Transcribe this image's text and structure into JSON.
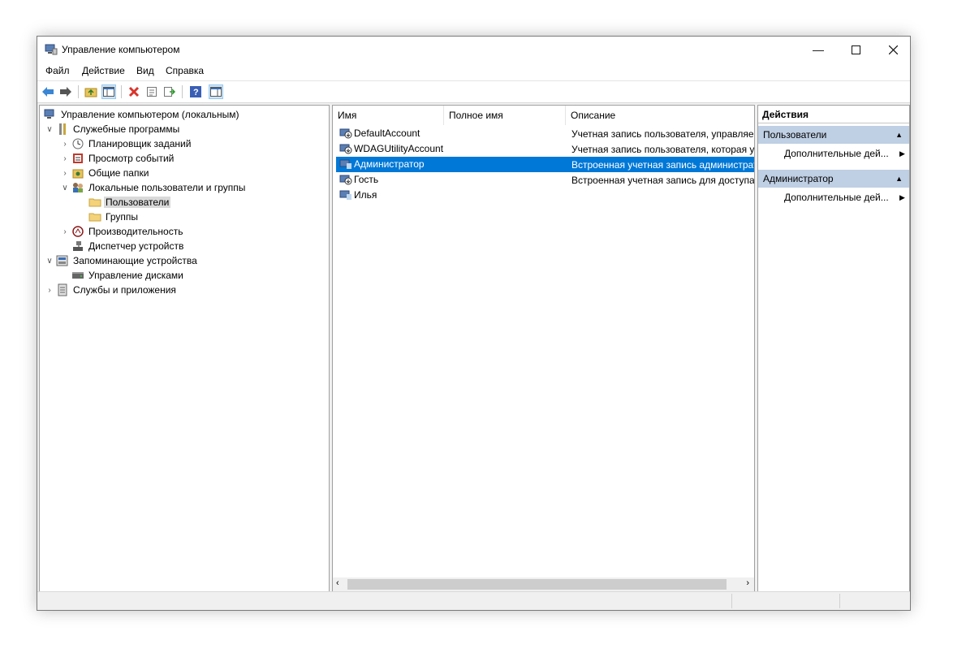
{
  "window": {
    "title": "Управление компьютером"
  },
  "menu": [
    "Файл",
    "Действие",
    "Вид",
    "Справка"
  ],
  "toolbar": {
    "icons": [
      "back-arrow-icon",
      "forward-arrow-icon",
      "up-folder-icon",
      "show-hide-tree-icon",
      "delete-icon",
      "properties-icon",
      "export-icon",
      "help-icon",
      "show-hide-action-pane-icon"
    ]
  },
  "tree": {
    "root": "Управление компьютером (локальным)",
    "system_tools": "Служебные программы",
    "task_scheduler": "Планировщик заданий",
    "event_viewer": "Просмотр событий",
    "shared_folders": "Общие папки",
    "local_users": "Локальные пользователи и группы",
    "users": "Пользователи",
    "groups": "Группы",
    "performance": "Производительность",
    "device_manager": "Диспетчер устройств",
    "storage": "Запоминающие устройства",
    "disk_management": "Управление дисками",
    "services_apps": "Службы и приложения"
  },
  "list": {
    "columns": [
      "Имя",
      "Полное имя",
      "Описание"
    ],
    "rows": [
      {
        "name": "DefaultAccount",
        "full_name": "",
        "description": "Учетная запись пользователя, управляе..."
      },
      {
        "name": "WDAGUtilityAccount",
        "full_name": "",
        "description": "Учетная запись пользователя, которая у..."
      },
      {
        "name": "Администратор",
        "full_name": "",
        "description": "Встроенная учетная запись администрат..."
      },
      {
        "name": "Гость",
        "full_name": "",
        "description": "Встроенная учетная запись для доступа ..."
      },
      {
        "name": "Илья",
        "full_name": "",
        "description": ""
      }
    ],
    "selected_index": 2
  },
  "actions": {
    "title": "Действия",
    "group1": "Пользователи",
    "group1_item": "Дополнительные дей...",
    "group2": "Администратор",
    "group2_item": "Дополнительные дей..."
  },
  "colors": {
    "selection": "#0078d7",
    "action_group": "#bfcfe4"
  }
}
